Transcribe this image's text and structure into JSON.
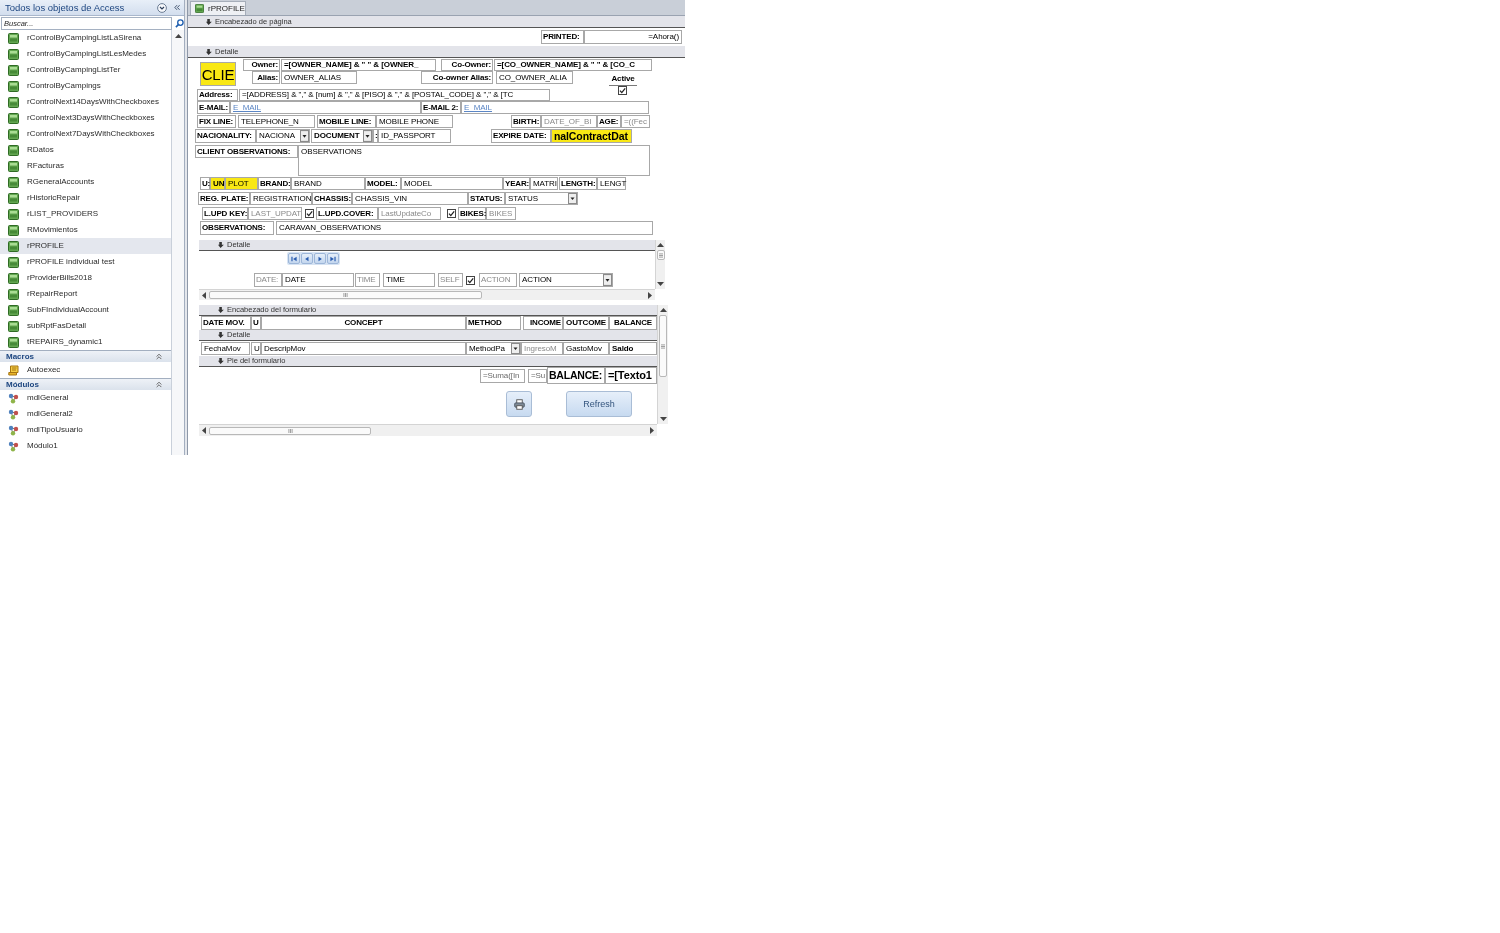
{
  "navigation_pane": {
    "title": "Todos los objetos de Access",
    "search": {
      "placeholder": "Buscar..."
    },
    "groups": [
      {
        "kind": "report",
        "items": [
          {
            "label": "rControlByCampingListLaSirena",
            "selected": false
          },
          {
            "label": "rControlByCampingListLesMedes",
            "selected": false
          },
          {
            "label": "rControlByCampingListTer",
            "selected": false
          },
          {
            "label": "rControlByCampings",
            "selected": false
          },
          {
            "label": "rControlNext14DaysWithCheckboxes",
            "selected": false
          },
          {
            "label": "rControlNext3DaysWithCheckboxes",
            "selected": false
          },
          {
            "label": "rControlNext7DaysWithCheckboxes",
            "selected": false
          },
          {
            "label": "RDatos",
            "selected": false
          },
          {
            "label": "RFacturas",
            "selected": false
          },
          {
            "label": "RGeneralAccounts",
            "selected": false
          },
          {
            "label": "rHistoricRepair",
            "selected": false
          },
          {
            "label": "rLIST_PROVIDERS",
            "selected": false
          },
          {
            "label": "RMovimientos",
            "selected": false
          },
          {
            "label": "rPROFILE",
            "selected": true
          },
          {
            "label": "rPROFILE individual test",
            "selected": false
          },
          {
            "label": "rProviderBills2018",
            "selected": false
          },
          {
            "label": "rRepairReport",
            "selected": false
          },
          {
            "label": "SubFIndividualAccount",
            "selected": false
          },
          {
            "label": "subRptFasDetall",
            "selected": false
          },
          {
            "label": "tREPAIRS_dynamic1",
            "selected": false
          }
        ]
      },
      {
        "kind": "macro",
        "title": "Macros",
        "items": [
          {
            "label": "Autoexec",
            "selected": false
          }
        ]
      },
      {
        "kind": "module",
        "title": "Módulos",
        "items": [
          {
            "label": "mdlGeneral",
            "selected": false
          },
          {
            "label": "mdlGeneral2",
            "selected": false
          },
          {
            "label": "mdlTipoUsuario",
            "selected": false
          },
          {
            "label": "Módulo1",
            "selected": false
          }
        ]
      }
    ]
  },
  "document": {
    "tab": {
      "title": "rPROFILE"
    },
    "page_header": {
      "title": "Encabezado de página",
      "controls": [
        {
          "kind": "label",
          "text": "PRINTED:"
        },
        {
          "kind": "text_box",
          "text": "=Ahora()"
        }
      ]
    },
    "detail": {
      "title": "Detalle",
      "controls": [
        {
          "kind": "text_box",
          "text": "CLIE"
        },
        {
          "kind": "label",
          "text": "Owner:"
        },
        {
          "kind": "text_box",
          "text": "=[OWNER_NAME] & \" \" & [OWNER_"
        },
        {
          "kind": "label",
          "text": "Co-Owner:"
        },
        {
          "kind": "text_box",
          "text": "=[CO_OWNER_NAME] & \" \" & [CO_C"
        },
        {
          "kind": "label",
          "text": "Alias:"
        },
        {
          "kind": "text_box",
          "text": "OWNER_ALIAS"
        },
        {
          "kind": "label",
          "text": "Co-owner Alias:"
        },
        {
          "kind": "text_box",
          "text": "CO_OWNER_ALIA"
        },
        {
          "kind": "label",
          "text": "Active"
        },
        {
          "kind": "check_box",
          "checked": true
        },
        {
          "kind": "label",
          "text": "Address:"
        },
        {
          "kind": "text_box",
          "text": "=[ADDRESS] & \",\" & [num] & \",\" & [PISO] & \",\" & [POSTAL_CODE] & \",\" & [TC"
        },
        {
          "kind": "label",
          "text": "E-MAIL:"
        },
        {
          "kind": "hyperlink",
          "text": "E_MAIL"
        },
        {
          "kind": "label",
          "text": "E-MAIL 2:"
        },
        {
          "kind": "hyperlink",
          "text": "E_MAIL"
        },
        {
          "kind": "label",
          "text": "FIX LINE:"
        },
        {
          "kind": "text_box",
          "text": "TELEPHONE_N"
        },
        {
          "kind": "label",
          "text": "MOBILE LINE:"
        },
        {
          "kind": "text_box",
          "text": "MOBILE PHONE"
        },
        {
          "kind": "label",
          "text": "BIRTH:"
        },
        {
          "kind": "text_box",
          "text": "DATE_OF_BI"
        },
        {
          "kind": "label",
          "text": "AGE:"
        },
        {
          "kind": "text_box",
          "text": "=((Fec"
        },
        {
          "kind": "label",
          "text": "NACIONALITY:"
        },
        {
          "kind": "combo_box",
          "text": "NACIONA"
        },
        {
          "kind": "combo_box",
          "text": "DOCUMENT"
        },
        {
          "kind": "label",
          "text": ":"
        },
        {
          "kind": "text_box",
          "text": "ID_PASSPORT"
        },
        {
          "kind": "label",
          "text": "EXPIRE DATE:"
        },
        {
          "kind": "text_box",
          "text": "nalContractDat"
        },
        {
          "kind": "label",
          "text": "CLIENT OBSERVATIONS:"
        },
        {
          "kind": "text_box",
          "text": "OBSERVATIONS"
        },
        {
          "kind": "label",
          "text": "U:"
        },
        {
          "kind": "text_box",
          "text": "UN"
        },
        {
          "kind": "text_box",
          "text": "PLOT"
        },
        {
          "kind": "label",
          "text": "BRAND:"
        },
        {
          "kind": "text_box",
          "text": "BRAND"
        },
        {
          "kind": "label",
          "text": "MODEL:"
        },
        {
          "kind": "text_box",
          "text": "MODEL"
        },
        {
          "kind": "label",
          "text": "YEAR:"
        },
        {
          "kind": "text_box",
          "text": "MATRI"
        },
        {
          "kind": "label",
          "text": "LENGTH:"
        },
        {
          "kind": "text_box",
          "text": "LENGT"
        },
        {
          "kind": "label",
          "text": "REG. PLATE:"
        },
        {
          "kind": "text_box",
          "text": "REGISTRATION"
        },
        {
          "kind": "label",
          "text": "CHASSIS:"
        },
        {
          "kind": "text_box",
          "text": "CHASSIS_VIN"
        },
        {
          "kind": "label",
          "text": "STATUS:"
        },
        {
          "kind": "combo_box",
          "text": "STATUS"
        },
        {
          "kind": "label",
          "text": "L.UPD KEY:"
        },
        {
          "kind": "text_box",
          "text": "LAST_UPDAT"
        },
        {
          "kind": "check_box",
          "checked": true
        },
        {
          "kind": "label",
          "text": "L.UPD.COVER:"
        },
        {
          "kind": "text_box",
          "text": "LastUpdateCo"
        },
        {
          "kind": "check_box",
          "checked": true
        },
        {
          "kind": "label",
          "text": "BIKES:"
        },
        {
          "kind": "text_box",
          "text": "BIKES"
        },
        {
          "kind": "label",
          "text": "OBSERVATIONS:"
        },
        {
          "kind": "text_box",
          "text": "CARAVAN_OBSERVATIONS"
        }
      ],
      "subforms": [
        {
          "sections": [
            {
              "title": "Detalle",
              "controls": [
                {
                  "kind": "navigation_buttons"
                },
                {
                  "kind": "label",
                  "text": "DATE:"
                },
                {
                  "kind": "text_box",
                  "text": "DATE"
                },
                {
                  "kind": "label",
                  "text": "TIME"
                },
                {
                  "kind": "text_box",
                  "text": "TIME"
                },
                {
                  "kind": "label",
                  "text": "SELF"
                },
                {
                  "kind": "check_box",
                  "checked": true
                },
                {
                  "kind": "label",
                  "text": "ACTION"
                },
                {
                  "kind": "combo_box",
                  "text": "ACTION"
                }
              ]
            }
          ]
        },
        {
          "sections": [
            {
              "title": "Encabezado del formulario",
              "controls": [
                {
                  "kind": "label",
                  "text": "DATE MOV."
                },
                {
                  "kind": "label",
                  "text": "U"
                },
                {
                  "kind": "label",
                  "text": "CONCEPT"
                },
                {
                  "kind": "label",
                  "text": "METHOD"
                },
                {
                  "kind": "label",
                  "text": "INCOME"
                },
                {
                  "kind": "label",
                  "text": "OUTCOME"
                },
                {
                  "kind": "label",
                  "text": "BALANCE"
                }
              ]
            },
            {
              "title": "Detalle",
              "controls": [
                {
                  "kind": "text_box",
                  "text": "FechaMov"
                },
                {
                  "kind": "text_box",
                  "text": "U"
                },
                {
                  "kind": "text_box",
                  "text": "DescripMov"
                },
                {
                  "kind": "combo_box",
                  "text": "MethodPa"
                },
                {
                  "kind": "text_box",
                  "text": "IngresoM"
                },
                {
                  "kind": "text_box",
                  "text": "GastoMov"
                },
                {
                  "kind": "text_box",
                  "text": "Saldo"
                }
              ]
            },
            {
              "title": "Pie del formulario",
              "controls": [
                {
                  "kind": "text_box",
                  "text": "=Suma([In"
                },
                {
                  "kind": "text_box",
                  "text": "=Su"
                },
                {
                  "kind": "label",
                  "text": "BALANCE:"
                },
                {
                  "kind": "text_box",
                  "text": "=[Texto1"
                },
                {
                  "kind": "icon_button"
                },
                {
                  "kind": "button",
                  "text": "Refresh"
                }
              ]
            }
          ]
        }
      ]
    }
  }
}
